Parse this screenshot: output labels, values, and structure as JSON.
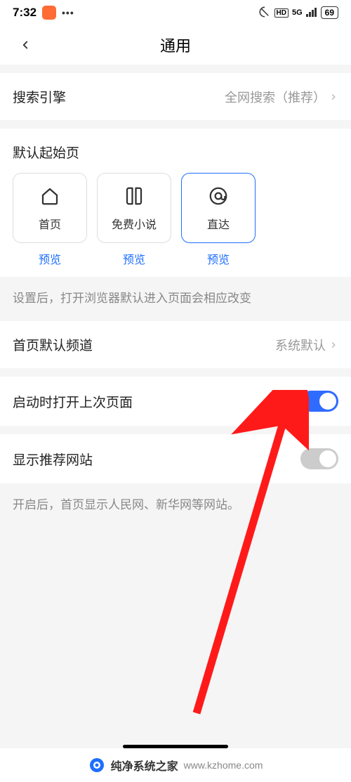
{
  "status": {
    "time": "7:32",
    "battery": "69",
    "network": "5G"
  },
  "header": {
    "title": "通用"
  },
  "search_engine": {
    "label": "搜索引擎",
    "value": "全网搜索（推荐）"
  },
  "start_page": {
    "title": "默认起始页",
    "tiles": [
      {
        "label": "首页",
        "preview": "预览",
        "icon": "house-icon",
        "selected": false
      },
      {
        "label": "免费小说",
        "preview": "预览",
        "icon": "book-icon",
        "selected": false
      },
      {
        "label": "直达",
        "preview": "预览",
        "icon": "at-icon",
        "selected": true
      }
    ],
    "hint": "设置后，打开浏览器默认进入页面会相应改变"
  },
  "default_channel": {
    "label": "首页默认频道",
    "value": "系统默认"
  },
  "resume_last": {
    "label": "启动时打开上次页面",
    "on": true
  },
  "recommend_sites": {
    "label": "显示推荐网站",
    "on": false,
    "description": "开启后，首页显示人民网、新华网等网站。"
  },
  "watermark": {
    "text": "纯净系统之家",
    "url": "www.kzhome.com"
  }
}
